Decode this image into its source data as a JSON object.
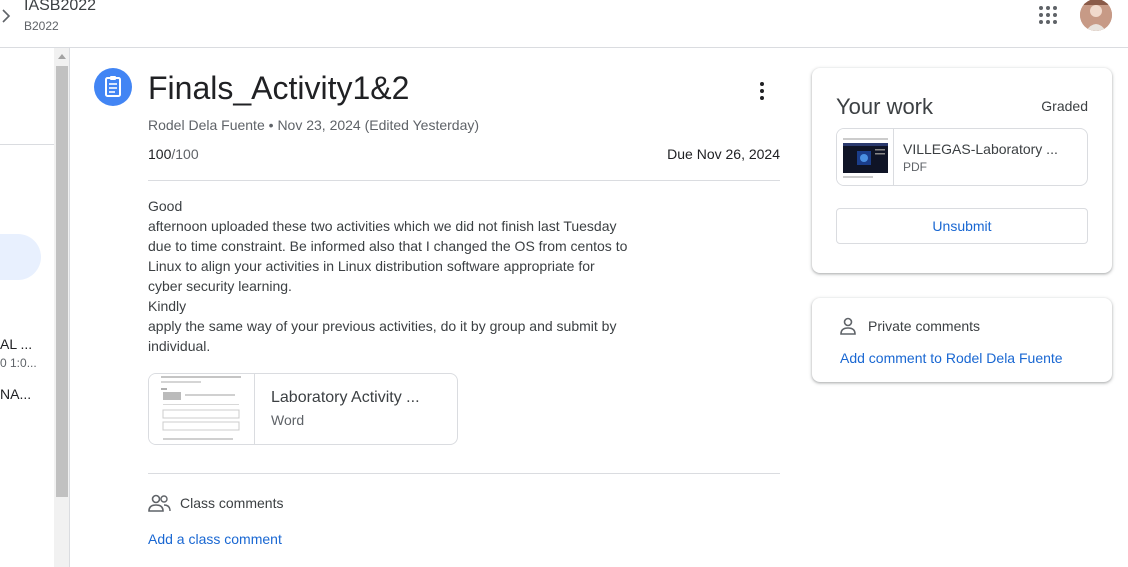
{
  "header": {
    "class_name": "IASB2022",
    "section": "B2022"
  },
  "sidebar": {
    "item1_line1": "AL ...",
    "item1_line2": "0 1:0...",
    "item2": "NA..."
  },
  "assignment": {
    "title": "Finals_Activity1&2",
    "author": "Rodel Dela Fuente",
    "posted": "Nov 23, 2024 (Edited Yesterday)",
    "points_earned": "100",
    "points_total": "/100",
    "due": "Due Nov 26, 2024",
    "description": [
      "Good",
      "afternoon uploaded these two activities which we did not finish last Tuesday",
      "due to time constraint. Be informed also that I changed the OS from centos to",
      "Linux to align your activities in Linux distribution software appropriate for",
      "cyber security learning.",
      "Kindly",
      "apply the same way of your previous activities, do it by group and submit by",
      "individual."
    ],
    "attachment": {
      "title": "Laboratory Activity ...",
      "type": "Word"
    }
  },
  "class_comments": {
    "label": "Class comments",
    "add_link": "Add a class comment"
  },
  "your_work": {
    "title": "Your work",
    "status": "Graded",
    "file": {
      "title": "VILLEGAS-Laboratory ...",
      "type": "PDF"
    },
    "unsubmit_label": "Unsubmit"
  },
  "private_comments": {
    "label": "Private comments",
    "add_link": "Add comment to Rodel Dela Fuente"
  },
  "colors": {
    "accent_blue": "#1967d2",
    "icon_blue": "#4285f4",
    "border": "#dadce0"
  },
  "icons": [
    "chevron-right-icon",
    "apps-grid-icon",
    "avatar",
    "assignment-icon",
    "more-vert-icon",
    "people-icon",
    "person-icon"
  ]
}
